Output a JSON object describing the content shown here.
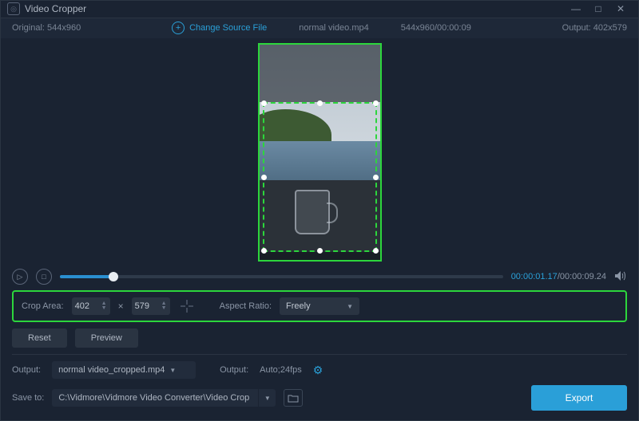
{
  "titlebar": {
    "title": "Video Cropper"
  },
  "infobar": {
    "original_label": "Original:  544x960",
    "change_source": "Change Source File",
    "filename": "normal video.mp4",
    "source_info": "544x960/00:00:09",
    "output_label": "Output: 402x579"
  },
  "playbar": {
    "current_time": "00:00:01.17",
    "sep": "/",
    "total_time": "00:00:09.24"
  },
  "crop": {
    "area_label": "Crop Area:",
    "width": "402",
    "height": "579",
    "aspect_label": "Aspect Ratio:",
    "aspect_value": "Freely"
  },
  "buttons": {
    "reset": "Reset",
    "preview": "Preview",
    "export": "Export"
  },
  "output": {
    "label1": "Output:",
    "filename": "normal video_cropped.mp4",
    "label2": "Output:",
    "settings": "Auto;24fps"
  },
  "save": {
    "label": "Save to:",
    "path": "C:\\Vidmore\\Vidmore Video Converter\\Video Crop"
  }
}
